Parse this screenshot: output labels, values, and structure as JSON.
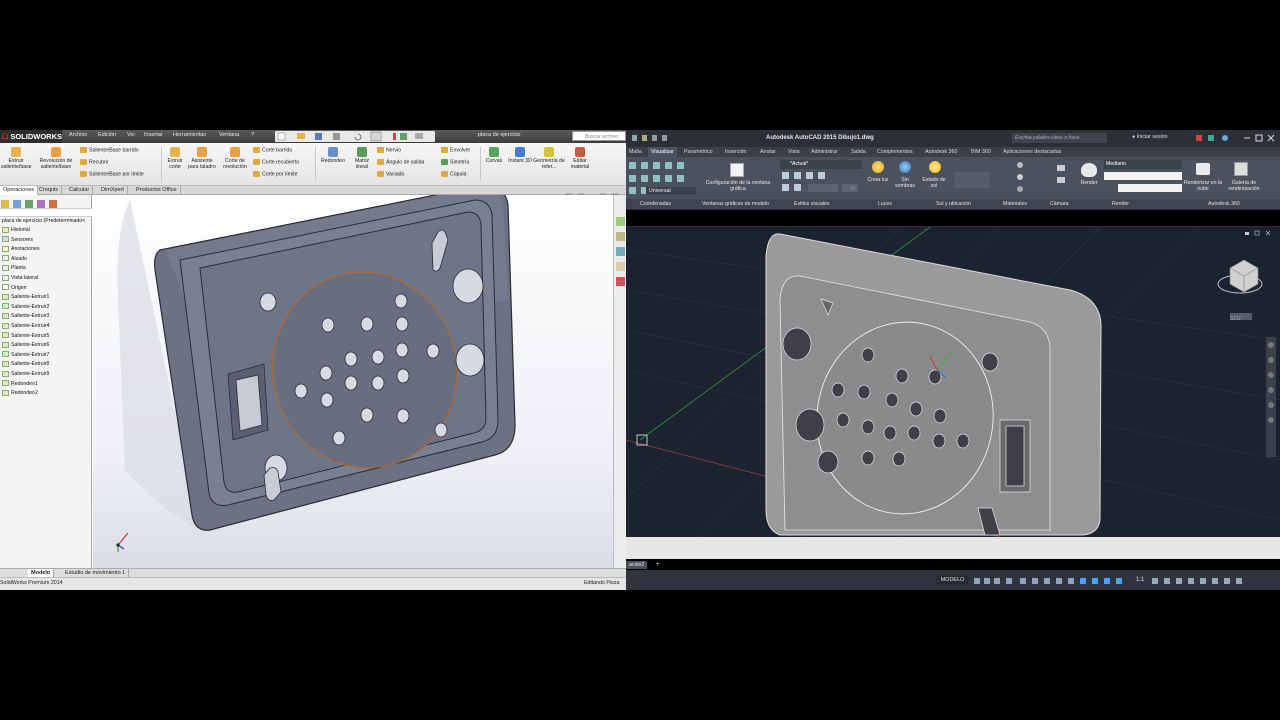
{
  "solidworks": {
    "logo": "SOLIDWORKS",
    "menu": [
      "Archivo",
      "Edición",
      "Ver",
      "Insertar",
      "Herramientas",
      "Ventana",
      "?"
    ],
    "doc_title": "placa de ejercicio",
    "search_placeholder": "Buscar archivo",
    "ribbon": {
      "big": [
        {
          "label": "Extruir saliente/base"
        },
        {
          "label": "Revolución de saliente/base"
        }
      ],
      "col1": [
        "Saliente/Base barrido",
        "Recubrir",
        "Saliente/Base por límite"
      ],
      "big2": [
        {
          "label": "Extruir corte"
        },
        {
          "label": "Asistente para taladro"
        },
        {
          "label": "Corte de revolución"
        }
      ],
      "col2": [
        "Corte barrido",
        "Corte recubierto",
        "Corte por límite"
      ],
      "big3": [
        {
          "label": "Redondeo"
        },
        {
          "label": "Matriz lineal"
        }
      ],
      "col3": [
        "Nervio",
        "Ángulo de salida",
        "Vaciado"
      ],
      "col4": [
        "Envolver",
        "Simetría",
        "Cúpula"
      ],
      "big4": [
        {
          "label": "Curvas"
        },
        {
          "label": "Instant 3D"
        },
        {
          "label": "Geometría de refer..."
        },
        {
          "label": "Editar material"
        }
      ]
    },
    "tabs": [
      "Operaciones",
      "Croquis",
      "Calcular",
      "DimXpert",
      "Productos Office"
    ],
    "tree_root": "placa de ejercicio  (Predeterminado<",
    "tree": [
      "Historial",
      "Sensores",
      "Anotaciones",
      "Alzado",
      "Planta",
      "Vista lateral",
      "Origen",
      "Saliente-Extruir1",
      "Saliente-Extruir2",
      "Saliente-Extruir3",
      "Saliente-Extruir4",
      "Saliente-Extruir5",
      "Saliente-Extruir6",
      "Saliente-Extruir7",
      "Saliente-Extruir8",
      "Saliente-Extruir9",
      "Redondeo1",
      "Redondeo2"
    ],
    "bottom_tabs": [
      "Modelo",
      "Estudio de movimiento 1"
    ],
    "status_left": "SolidWorks Premium 2014",
    "status_right": "Editando Pieza"
  },
  "autocad": {
    "title": "Autodesk AutoCAD 2015   Dibujo1.dwg",
    "search_placeholder": "Escriba palabra clave o frase",
    "signin": "Iniciar sesión",
    "tabs": [
      "Malla",
      "Visualizar",
      "Paramétrico",
      "Inserción",
      "Anotar",
      "Vista",
      "Administrar",
      "Salida",
      "Complementos",
      "Autodesk 360",
      "BIM 360",
      "Aplicaciones destacadas"
    ],
    "active_tab": "Visualizar",
    "universal": "Universal",
    "actual": "*Actual*",
    "model_viewport_btn": "Configuración de la ventana gráfica",
    "lights": [
      "Crear luz",
      "Sin sombras",
      "Estado de sol"
    ],
    "render_quality": "Mediano",
    "render_buttons": [
      "Render",
      "Renderizar en la nube",
      "Galería de renderización"
    ],
    "exposure_value": "60",
    "groups": [
      "Coordenadas",
      "Ventanas gráficas de modelo",
      "Estilos visuales",
      "Luces",
      "Sol y ubicación",
      "Materiales",
      "Cámara",
      "Render",
      "Autodesk 360"
    ],
    "wcs": "SCU",
    "cmd_tab": "ación2",
    "model_label": "MODELO",
    "scale": "1:1"
  },
  "colors": {
    "sw_part": "#6d7385",
    "sw_part_top": "#8a90a2",
    "ac_part": "#9a9a9a",
    "ac_bg": "#1b2330"
  }
}
